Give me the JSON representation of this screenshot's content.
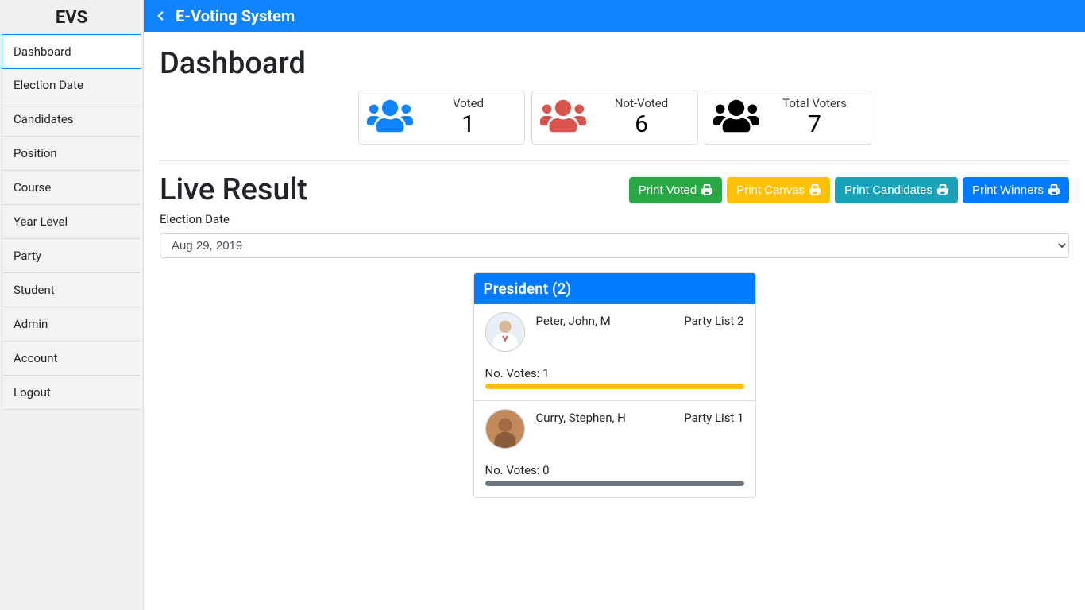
{
  "brand": "EVS",
  "topbar": {
    "title": "E-Voting System"
  },
  "sidebar": {
    "items": [
      {
        "label": "Dashboard",
        "active": true
      },
      {
        "label": "Election Date"
      },
      {
        "label": "Candidates"
      },
      {
        "label": "Position"
      },
      {
        "label": "Course"
      },
      {
        "label": "Year Level"
      },
      {
        "label": "Party"
      },
      {
        "label": "Student"
      },
      {
        "label": "Admin"
      },
      {
        "label": "Account"
      },
      {
        "label": "Logout"
      }
    ]
  },
  "page": {
    "title": "Dashboard",
    "live_title": "Live Result",
    "election_date_label": "Election Date",
    "election_date_value": "Aug 29, 2019"
  },
  "stats": [
    {
      "label": "Voted",
      "value": "1",
      "color": "#1083ff"
    },
    {
      "label": "Not-Voted",
      "value": "6",
      "color": "#d9534f"
    },
    {
      "label": "Total Voters",
      "value": "7",
      "color": "#000000"
    }
  ],
  "buttons": {
    "print_voted": "Print Voted",
    "print_canvas": "Print Canvas",
    "print_candidates": "Print Candidates",
    "print_winners": "Print Winners"
  },
  "result": {
    "header": "President (2)",
    "candidates": [
      {
        "name": "Peter, John, M",
        "party": "Party List 2",
        "votes_label": "No. Votes: 1",
        "bar": "yellow"
      },
      {
        "name": "Curry, Stephen, H",
        "party": "Party List 1",
        "votes_label": "No. Votes: 0",
        "bar": "gray"
      }
    ]
  }
}
